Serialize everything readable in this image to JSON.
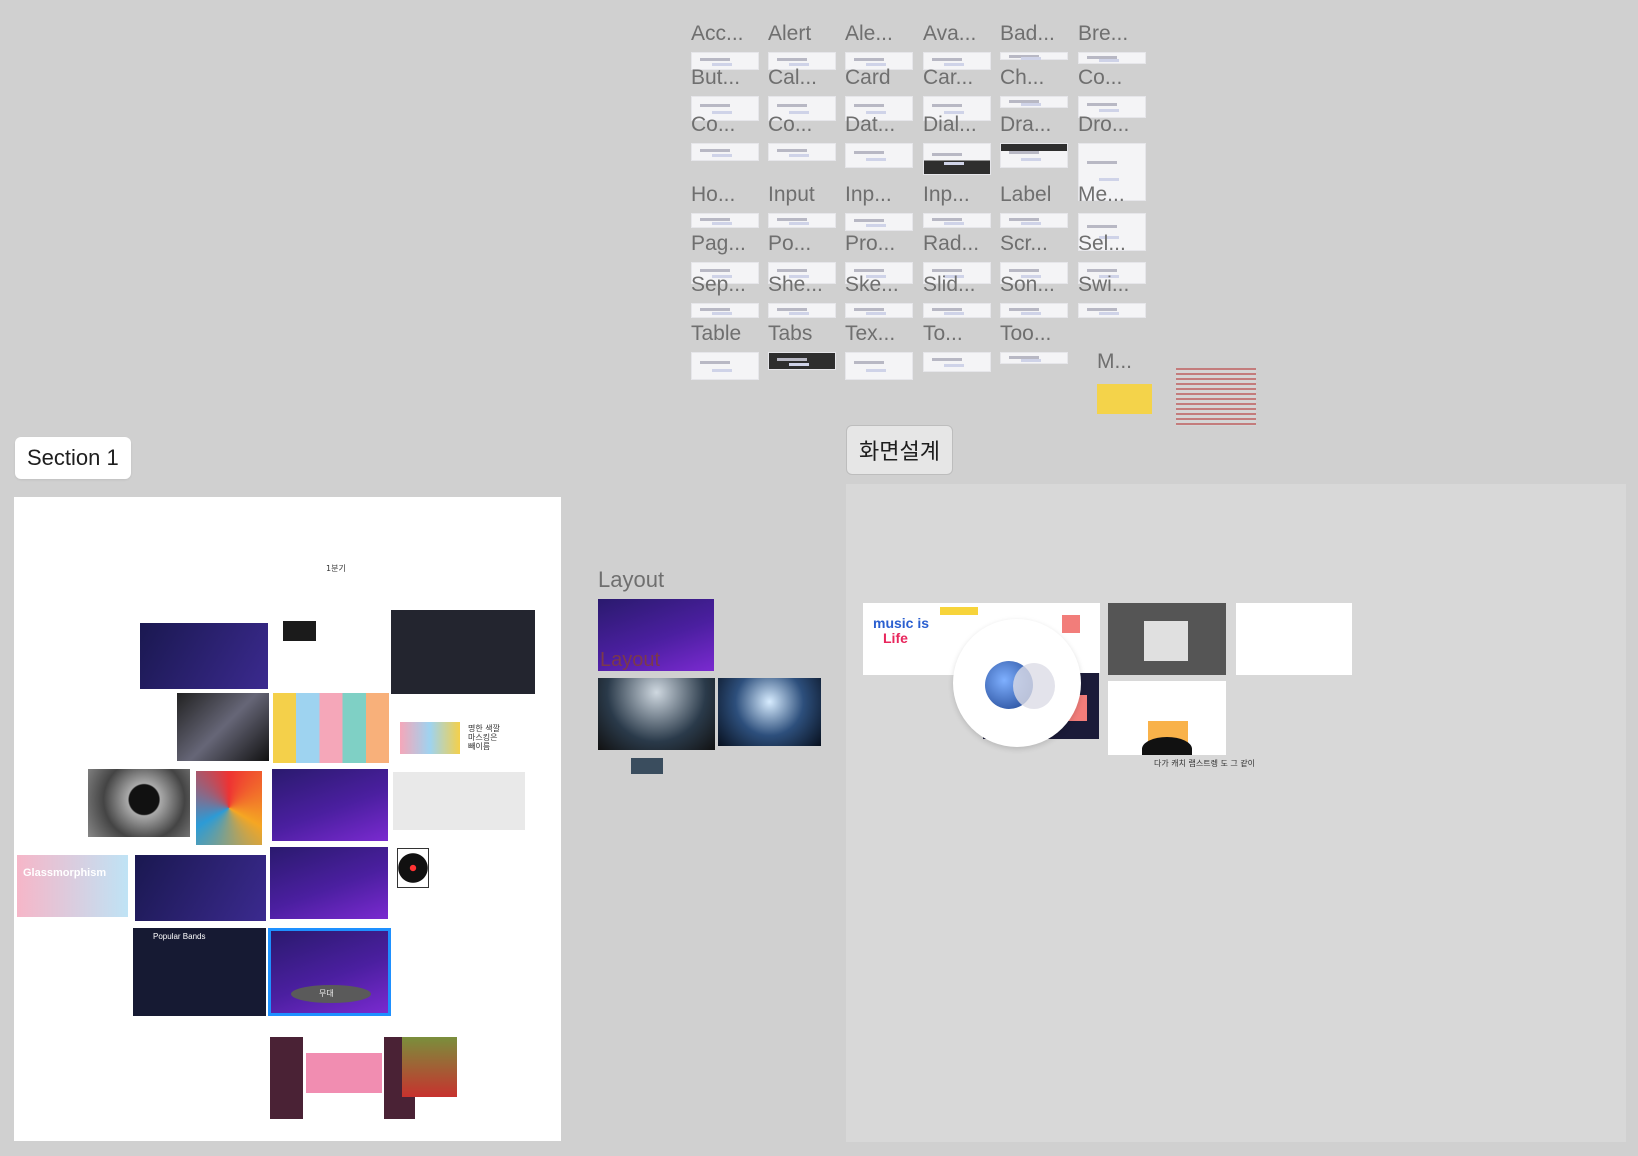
{
  "components": [
    {
      "label": "Acc..."
    },
    {
      "label": "Alert"
    },
    {
      "label": "Ale..."
    },
    {
      "label": "Ava..."
    },
    {
      "label": "Bad..."
    },
    {
      "label": "Bre..."
    },
    {
      "label": "But..."
    },
    {
      "label": "Cal..."
    },
    {
      "label": "Card"
    },
    {
      "label": "Car..."
    },
    {
      "label": "Ch..."
    },
    {
      "label": "Co..."
    },
    {
      "label": "Co..."
    },
    {
      "label": "Co..."
    },
    {
      "label": "Dat..."
    },
    {
      "label": "Dial..."
    },
    {
      "label": "Dra..."
    },
    {
      "label": "Dro..."
    },
    {
      "label": "Ho..."
    },
    {
      "label": "Input"
    },
    {
      "label": "Inp..."
    },
    {
      "label": "Inp..."
    },
    {
      "label": "Label"
    },
    {
      "label": "Me..."
    },
    {
      "label": "Pag..."
    },
    {
      "label": "Po..."
    },
    {
      "label": "Pro..."
    },
    {
      "label": "Rad..."
    },
    {
      "label": "Scr..."
    },
    {
      "label": "Sel..."
    },
    {
      "label": "Sep..."
    },
    {
      "label": "She..."
    },
    {
      "label": "Ske..."
    },
    {
      "label": "Slid..."
    },
    {
      "label": "Son..."
    },
    {
      "label": "Swi..."
    },
    {
      "label": "Table"
    },
    {
      "label": "Tabs"
    },
    {
      "label": "Tex..."
    },
    {
      "label": "To..."
    },
    {
      "label": "Too..."
    }
  ],
  "extra_label": "M...",
  "section1": {
    "title": "Section 1",
    "tiny_text": "1분기"
  },
  "layout": {
    "title": "Layout",
    "frame_text": "Layout"
  },
  "screen_design": {
    "title": "화면설계"
  },
  "thumbs": {
    "glass_text": "Glassmorphism",
    "stage_text": "무대",
    "palette_text": "명한 색깔\n마스킹은\n빼이름",
    "popular_bands": "Popular Bands",
    "music_is": "music is",
    "life": "Life",
    "bottom_caption": "다가 캐치 랩스트렝 도 그 같이"
  },
  "colors": {
    "canvas": "#d0d0d0",
    "selection": "#1e90ff",
    "accent_pink": "#f4a6c3",
    "accent_yellow": "#f7d43b"
  }
}
